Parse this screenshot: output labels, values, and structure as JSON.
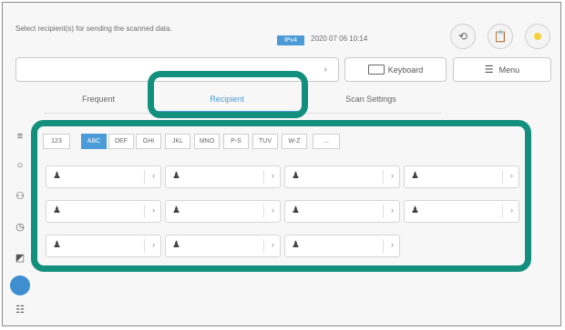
{
  "status_message": "Select recipient(s) for sending the scanned data.",
  "ip_badge": "IPv4",
  "datetime": "2020 07 06 10:14",
  "toolbar": {
    "history_icon": "history-icon",
    "clipboard_icon": "clipboard-check-icon",
    "status_indicator_color": "#f3d23a"
  },
  "address": {
    "value": "",
    "arrow": "›"
  },
  "keyboard_button": {
    "icon": "keyboard-icon",
    "label": "Keyboard"
  },
  "menu_button": {
    "icon": "menu-icon",
    "label": "Menu"
  },
  "tabs": [
    {
      "label": "Frequent",
      "active": false
    },
    {
      "label": "Recipient",
      "active": true
    },
    {
      "label": "Scan Settings",
      "active": false
    }
  ],
  "alpha_tabs": [
    {
      "label": "123",
      "active": false
    },
    {
      "label": "ABC",
      "active": true
    },
    {
      "label": "DEF",
      "active": false
    },
    {
      "label": "GHI",
      "active": false
    },
    {
      "label": "JKL",
      "active": false
    },
    {
      "label": "MNO",
      "active": false
    },
    {
      "label": "P-S",
      "active": false
    },
    {
      "label": "TUV",
      "active": false
    },
    {
      "label": "W-Z",
      "active": false
    },
    {
      "label": "...",
      "active": false
    }
  ],
  "recipients": [
    {
      "person_icon": "person-icon",
      "chevron": "›"
    },
    {
      "person_icon": "person-icon",
      "chevron": "›"
    },
    {
      "person_icon": "person-icon",
      "chevron": "›"
    },
    {
      "person_icon": "person-icon",
      "chevron": "›"
    },
    {
      "person_icon": "person-icon",
      "chevron": "›"
    },
    {
      "person_icon": "person-icon",
      "chevron": "›"
    },
    {
      "person_icon": "person-icon",
      "chevron": "›"
    },
    {
      "person_icon": "person-icon",
      "chevron": "›"
    },
    {
      "person_icon": "person-icon",
      "chevron": "›"
    },
    {
      "person_icon": "person-icon",
      "chevron": "›"
    },
    {
      "person_icon": "person-icon",
      "chevron": "›"
    }
  ],
  "sidebar_icons": [
    "list-icon",
    "search-icon",
    "group-icon",
    "history-icon",
    "scan-icon",
    "selected-icon",
    "list-detail-icon"
  ],
  "highlight_color": "#138f7d",
  "accent_color": "#4b9bd8"
}
